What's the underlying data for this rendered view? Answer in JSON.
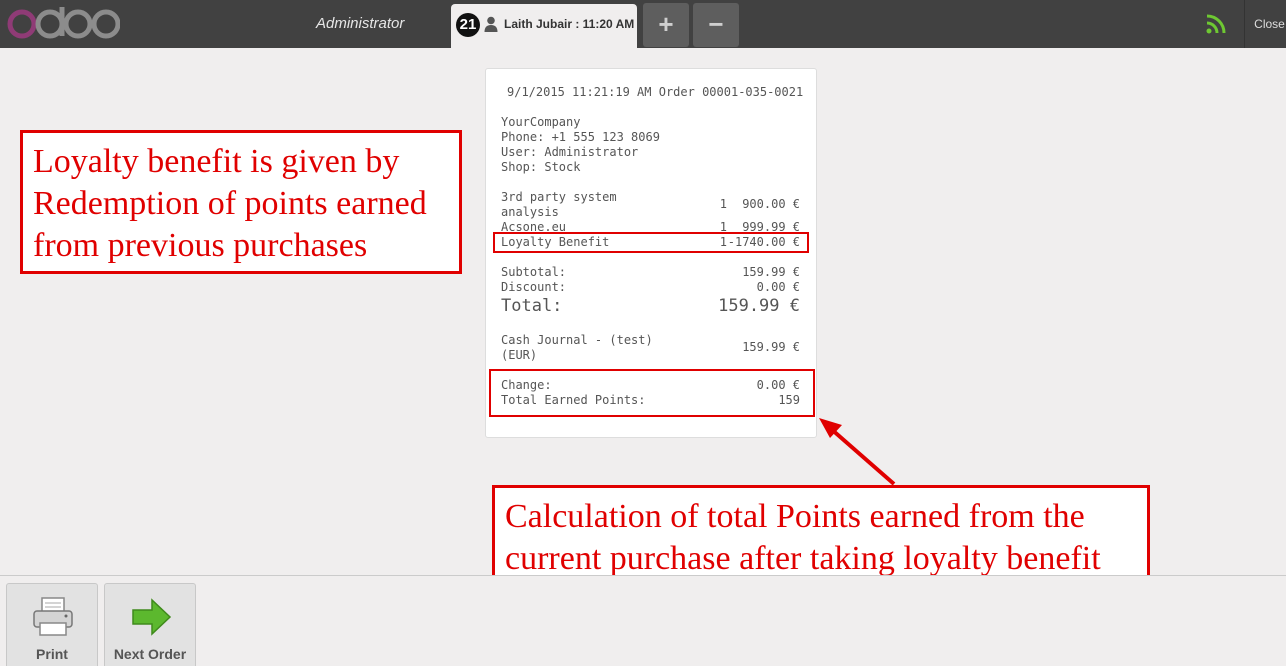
{
  "header": {
    "logo_text": "odoo",
    "user": "Administrator",
    "order_tab": {
      "number": "21",
      "label": "Laith Jubair : 11:20 AM"
    },
    "add_label": "+",
    "remove_label": "−",
    "close_label": "Close",
    "icons": {
      "logo": "odoo-logo",
      "person": "person-icon",
      "connection": "wifi-signal-icon"
    },
    "colors": {
      "logo_o": "#8f3b76",
      "logo_doo": "#8c8c8c",
      "signal": "#6ec832"
    }
  },
  "receipt": {
    "header_line": "9/1/2015 11:21:19 AM Order 00001-035-0021",
    "company": "YourCompany",
    "phone": "Phone: +1 555 123 8069",
    "user": "User: Administrator",
    "shop": "Shop: Stock",
    "lines": [
      {
        "name_1": "3rd party system",
        "name_2": "analysis",
        "qty": "1",
        "price": "900.00 €"
      },
      {
        "name": "Acsone.eu",
        "qty": "1",
        "price": "999.99 €"
      },
      {
        "name": "Loyalty Benefit",
        "qty": "1",
        "price": "-1740.00 €"
      }
    ],
    "subtotal_label": "Subtotal:",
    "subtotal_value": "159.99 €",
    "discount_label": "Discount:",
    "discount_value": "0.00 €",
    "total_label": "Total:",
    "total_value": "159.99 €",
    "payment_label_1": "Cash Journal - (test)",
    "payment_label_2": "(EUR)",
    "payment_value": "159.99 €",
    "change_label": "Change:",
    "change_value": "0.00 €",
    "points_label": "Total Earned Points:",
    "points_value": "159"
  },
  "annotations": {
    "callout_1": [
      "Loyalty benefit is given by",
      "Redemption of points earned",
      "from previous purchases"
    ],
    "callout_2": [
      "Calculation of total Points earned from the",
      "current purchase after taking loyalty benefit"
    ],
    "color": "#e00000"
  },
  "footer": {
    "print_label": "Print",
    "next_label": "Next Order",
    "icons": {
      "print": "printer-icon",
      "next": "next-arrow-icon"
    }
  }
}
